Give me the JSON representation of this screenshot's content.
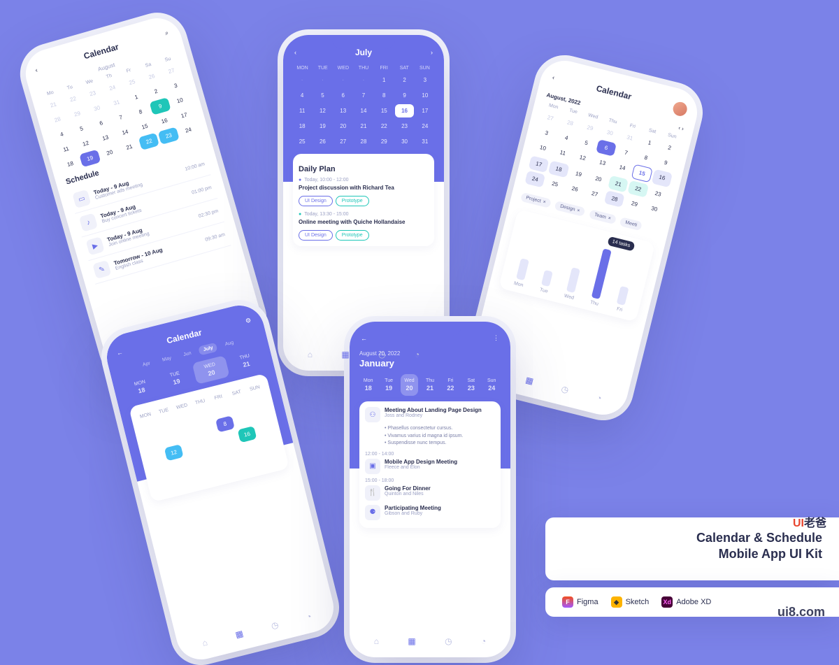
{
  "colors": {
    "primary": "#6a6fe8",
    "teal": "#1fc6b8",
    "blue": "#44bdf4",
    "text": "#2a2e4f",
    "muted": "#9ba0c4"
  },
  "promo": {
    "title_line1": "Calendar & Schedule",
    "title_line2": "Mobile App UI Kit",
    "tools": [
      {
        "name": "Figma"
      },
      {
        "name": "Sketch"
      },
      {
        "name": "Adobe XD"
      }
    ],
    "watermark": "ui8.com",
    "watermark_cn": "UI老爸"
  },
  "nav_icons": [
    "home",
    "calendar",
    "clock",
    "bell"
  ],
  "screen1": {
    "title": "Calendar",
    "month": "August",
    "dow": [
      "Mo",
      "Tu",
      "We",
      "Th",
      "Fr",
      "Sa",
      "Su"
    ],
    "schedule_title": "Schedule",
    "events": [
      {
        "date": "Today - 9 Aug",
        "title": "Customer ads meeting",
        "time": "10:00 am"
      },
      {
        "date": "Today - 9 Aug",
        "title": "Buy concert tickets",
        "time": "01:00 pm"
      },
      {
        "date": "Today - 9 Aug",
        "title": "Join online meeting",
        "time": "02:30 pm"
      },
      {
        "date": "Tomorrow - 10 Aug",
        "title": "English class",
        "time": "09:30 am"
      }
    ]
  },
  "screen2": {
    "month": "July",
    "dow": [
      "MON",
      "TUE",
      "WED",
      "THU",
      "FRI",
      "SAT",
      "SUN"
    ],
    "selected_day": "16",
    "plan_title": "Daily Plan",
    "items": [
      {
        "time": "Today, 10:00 - 12:00",
        "title": "Project discussion with Richard Tea",
        "chips": [
          "UI Design",
          "Prototype"
        ]
      },
      {
        "time": "Today, 13:30 - 15:00",
        "title": "Online meeting with Quiche Hollandaise",
        "chips": [
          "UI Design",
          "Prototype"
        ]
      }
    ]
  },
  "screen3": {
    "title": "Calendar",
    "month": "August, 2022",
    "dow": [
      "Mon",
      "Tue",
      "Wed",
      "Thu",
      "Fri",
      "Sat",
      "Sun"
    ],
    "tags": [
      "Project",
      "Design",
      "Team",
      "Meeti"
    ],
    "chart": {
      "categories": [
        "Mon",
        "Tue",
        "Wed",
        "Thu",
        "Fri"
      ],
      "values": [
        35,
        25,
        40,
        85,
        30
      ],
      "highlight_index": 3,
      "highlight_label": "14 tasks"
    }
  },
  "screen4": {
    "title": "Calendar",
    "months": [
      "Apr",
      "May",
      "Jun",
      "July",
      "Aug"
    ],
    "current_month": "July",
    "week": [
      {
        "d": "MON",
        "n": "18"
      },
      {
        "d": "TUE",
        "n": "19"
      },
      {
        "d": "WED",
        "n": "20"
      },
      {
        "d": "THU",
        "n": "21"
      }
    ],
    "dow": [
      "MON",
      "TUE",
      "WED",
      "THU",
      "FRI",
      "SAT",
      "SUN"
    ]
  },
  "screen5": {
    "date": "August 20, 2022",
    "month": "January",
    "week": [
      {
        "d": "Mon",
        "n": "18"
      },
      {
        "d": "Tue",
        "n": "19"
      },
      {
        "d": "Wed",
        "n": "20"
      },
      {
        "d": "Thu",
        "n": "21"
      },
      {
        "d": "Fri",
        "n": "22"
      },
      {
        "d": "Sat",
        "n": "23"
      },
      {
        "d": "Sun",
        "n": "24"
      }
    ],
    "events": [
      {
        "title": "Meeting About Landing Page Design",
        "who": "Joss and Rodney",
        "bullets": [
          "Phasellus consectetur cursus.",
          "Vivamus varius id magna id ipsum.",
          "Suspendisse nunc tempus."
        ]
      },
      {
        "time": "12:00 - 14:00",
        "title": "Mobile App Design Meeting",
        "who": "Fleece and Elon"
      },
      {
        "time": "15:00 - 18:00",
        "title": "Going For Dinner",
        "who": "Quinton and Niles"
      },
      {
        "title": "Participating Meeting",
        "who": "Gibson and Ruby"
      }
    ]
  }
}
